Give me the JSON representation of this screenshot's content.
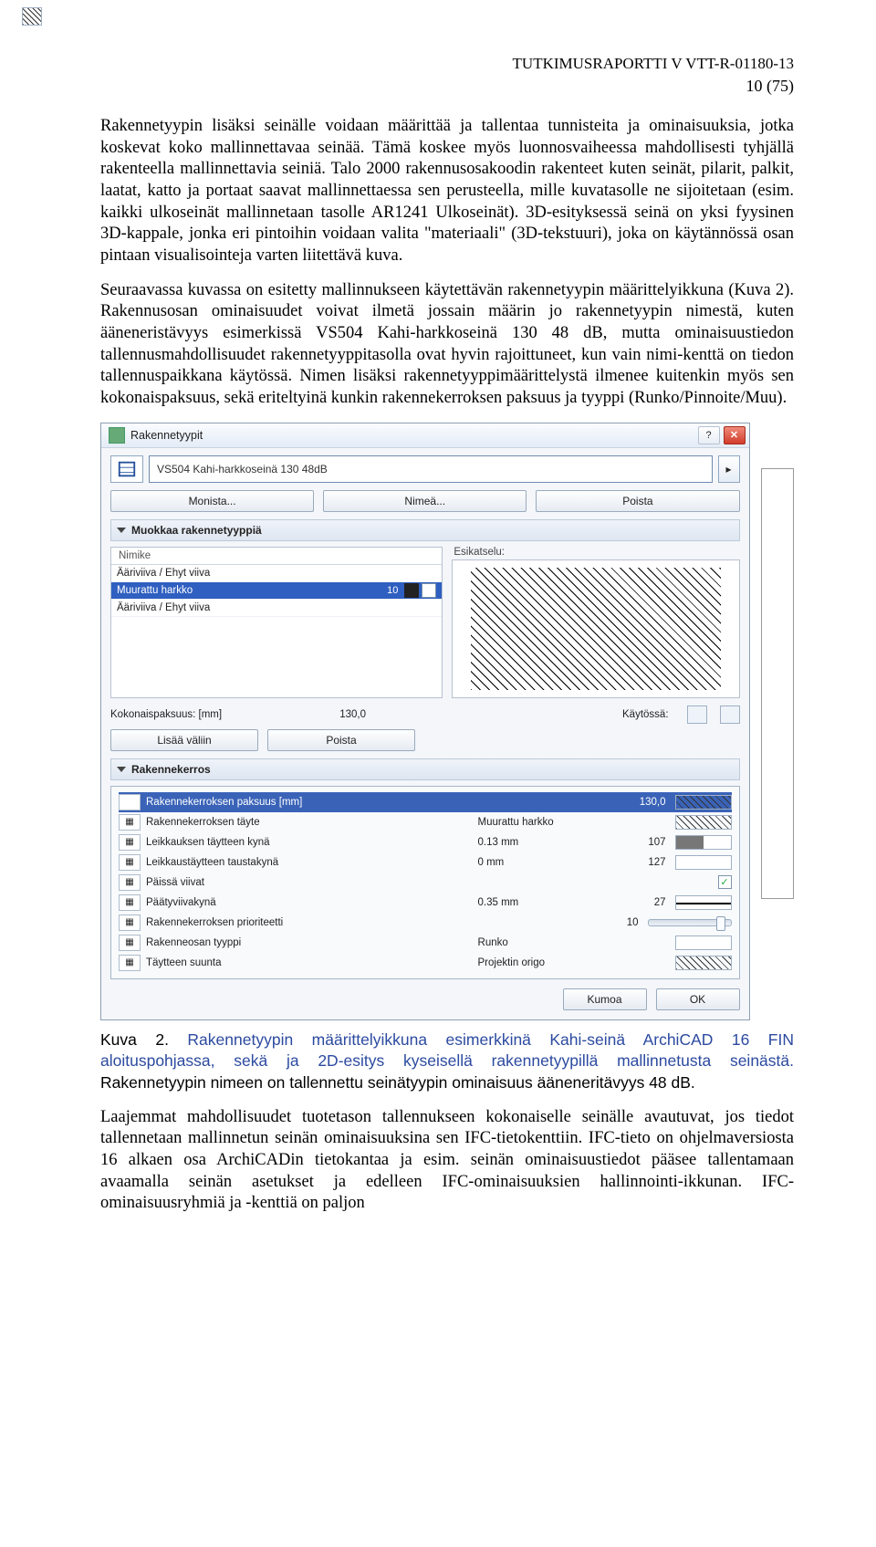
{
  "header": {
    "report": "TUTKIMUSRAPORTTI V VTT-R-01180-13",
    "page": "10 (75)"
  },
  "para1": "Rakennetyypin lisäksi seinälle voidaan määrittää ja tallentaa tunnisteita ja ominaisuuksia, jotka koskevat koko mallinnettavaa seinää. Tämä koskee myös luonnosvaiheessa mahdollisesti tyhjällä rakenteella mallinnettavia seiniä. Talo 2000 rakennusosakoodin rakenteet kuten seinät, pilarit, palkit, laatat, katto ja portaat saavat mallinnettaessa sen perusteella, mille kuvatasolle ne sijoitetaan (esim. kaikki ulkoseinät mallinnetaan tasolle AR1241 Ulkoseinät). 3D-esityksessä seinä on yksi fyysinen 3D-kappale, jonka eri pintoihin voidaan valita \"materiaali\" (3D-tekstuuri), joka on käytännössä osan pintaan visualisointeja varten liitettävä kuva.",
  "para2": "Seuraavassa kuvassa on esitetty mallinnukseen käytettävän rakennetyypin määrittelyikkuna (Kuva 2). Rakennusosan ominaisuudet voivat ilmetä jossain määrin jo rakennetyypin nimestä, kuten ääneneristävyys esimerkissä VS504 Kahi-harkkoseinä 130 48 dB, mutta ominaisuustiedon tallennusmahdollisuudet rakennetyyppitasolla ovat hyvin rajoittuneet, kun vain nimi-kenttä on tiedon tallennuspaikkana käytössä. Nimen lisäksi rakennetyyppimäärittelystä ilmenee kuitenkin myös sen kokonaispaksuus, sekä eriteltyinä kunkin rakennekerroksen paksuus ja tyyppi (Runko/Pinnoite/Muu).",
  "dlg": {
    "title": "Rakennetyypit",
    "type_name": "VS504 Kahi-harkkoseinä 130 48dB",
    "buttons": {
      "monista": "Monista...",
      "nimea": "Nimeä...",
      "poista": "Poista"
    },
    "group_edit": "Muokkaa rakennetyyppiä",
    "layers": {
      "header": "Nimike",
      "rows": [
        {
          "name": "Ääriviiva / Ehyt viiva",
          "sel": false
        },
        {
          "name": "Muurattu harkko",
          "sel": true,
          "num": "10"
        },
        {
          "name": "Ääriviiva / Ehyt viiva",
          "sel": false
        }
      ]
    },
    "preview_label": "Esikatselu:",
    "tot": {
      "label": "Kokonaispaksuus: [mm]",
      "value": "130,0",
      "kayt": "Käytössä:"
    },
    "ins_btns": {
      "lisaa": "Lisää väliin",
      "poista": "Poista"
    },
    "group_layer": "Rakennekerros",
    "props": [
      {
        "name": "Rakennekerroksen paksuus [mm]",
        "val": "",
        "num": "130,0",
        "sw": "hatchsw",
        "hdr": true
      },
      {
        "name": "Rakennekerroksen täyte",
        "val": "Muurattu harkko",
        "num": "",
        "sw": "hatchsw"
      },
      {
        "name": "Leikkauksen täytteen kynä",
        "val": "0.13 mm",
        "num": "107",
        "sw": "half"
      },
      {
        "name": "Leikkaustäytteen taustakynä",
        "val": "0 mm",
        "num": "127",
        "sw": ""
      },
      {
        "name": "Päissä viivat",
        "val": "",
        "num": "",
        "sw": "",
        "check": true
      },
      {
        "name": "Päätyviivakynä",
        "val": "0.35 mm",
        "num": "27",
        "sw": "line"
      },
      {
        "name": "Rakennekerroksen prioriteetti",
        "val": "",
        "num": "10",
        "sw": "",
        "slider": true
      },
      {
        "name": "Rakenneosan tyyppi",
        "val": "Runko",
        "num": "",
        "sw": ""
      },
      {
        "name": "Täytteen suunta",
        "val": "Projektin origo",
        "num": "",
        "sw": "hatchsw"
      }
    ],
    "footer": {
      "kumoa": "Kumoa",
      "ok": "OK"
    }
  },
  "caption": {
    "lead": "Kuva 2.",
    "blue": " Rakennetyypin määrittelyikkuna esimerkkinä Kahi-seinä ArchiCAD 16 FIN aloituspohjassa, sekä ja 2D-esitys kyseisellä rakennetyypillä mallinnetusta seinästä.",
    "black2": " Rakennetyypin nimeen on tallennettu seinätyypin ominaisuus ääneneritävyys 48 dB."
  },
  "para3": "Laajemmat mahdollisuudet tuotetason tallennukseen kokonaiselle seinälle avautuvat, jos tiedot tallennetaan mallinnetun seinän ominaisuuksina sen IFC-tietokenttiin. IFC-tieto on ohjelmaversiosta 16 alkaen osa ArchiCADin tietokantaa ja esim. seinän ominaisuustiedot pääsee tallentamaan avaamalla seinän asetukset ja edelleen IFC-ominaisuuksien hallinnointi-ikkunan. IFC-ominaisuusryhmiä ja -kenttiä on paljon"
}
